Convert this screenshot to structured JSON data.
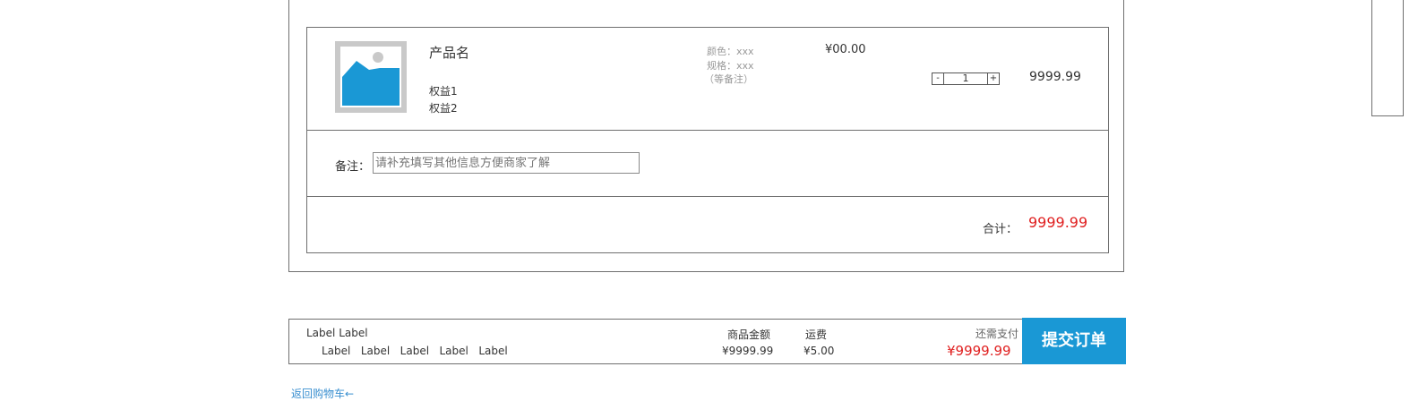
{
  "product": {
    "name": "产品名",
    "benefits": [
      "权益1",
      "权益2"
    ],
    "specs": [
      "颜色：xxx",
      "规格：xxx",
      "（等备注）"
    ],
    "price": "¥00.00",
    "quantity": {
      "minus": "-",
      "value": "1",
      "plus": "+"
    },
    "subtotal": "9999.99"
  },
  "note": {
    "label": "备注：",
    "placeholder": "请补充填写其他信息方便商家了解"
  },
  "total": {
    "label": "合计：",
    "value": "9999.99"
  },
  "summary": {
    "label_title": "Label Label",
    "labels": [
      "Label",
      "Label",
      "Label",
      "Label",
      "Label"
    ],
    "goods_amount_label": "商品金额",
    "goods_amount": "¥9999.99",
    "shipping_label": "运费",
    "shipping": "¥5.00",
    "due_label": "还需支付",
    "due": "¥9999.99",
    "submit_label": "提交订单"
  },
  "back_link": "返回购物车←",
  "colors": {
    "accent": "#1a98d5",
    "price_red": "#e02020",
    "border": "#6f6f6f"
  }
}
